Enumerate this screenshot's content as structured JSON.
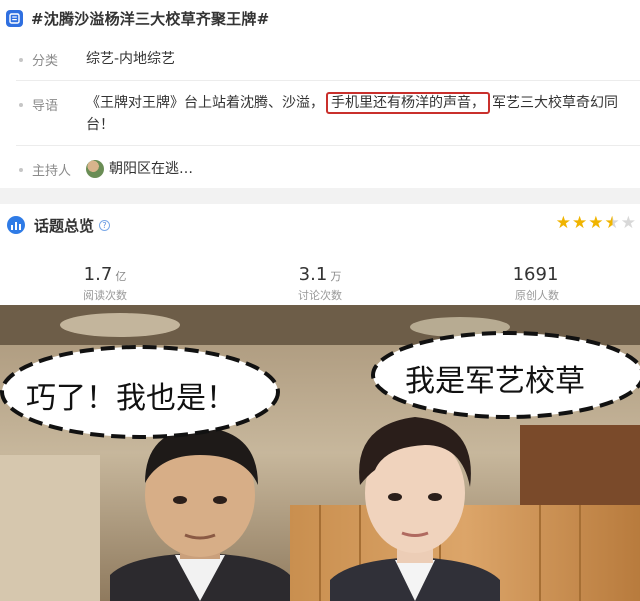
{
  "header": {
    "title": "#沈腾沙溢杨洋三大校草齐聚王牌#",
    "icon": "topic-icon"
  },
  "info": {
    "category_label": "分类",
    "category_value": "综艺-内地综艺",
    "intro_label": "导语",
    "intro_part1": "《王牌对王牌》台上站着沈腾、沙溢，",
    "intro_highlight": "手机里还有杨洋的声音，",
    "intro_part2": "军艺三大校草奇幻同",
    "intro_line2": "台！",
    "host_label": "主持人",
    "host_name": "朝阳区在逃…",
    "highlight_color": "#c9302c"
  },
  "overview": {
    "title": "话题总览",
    "rating": 3.5,
    "rating_max": 5,
    "star_color": "#f0b400",
    "stats": [
      {
        "number": "1.7",
        "unit": "亿",
        "label": "阅读次数"
      },
      {
        "number": "3.1",
        "unit": "万",
        "label": "讨论次数"
      },
      {
        "number": "1691",
        "unit": "",
        "label": "原创人数"
      }
    ]
  },
  "photo": {
    "bubble_left": "巧了！我也是！",
    "bubble_right": "我是军艺校草"
  }
}
